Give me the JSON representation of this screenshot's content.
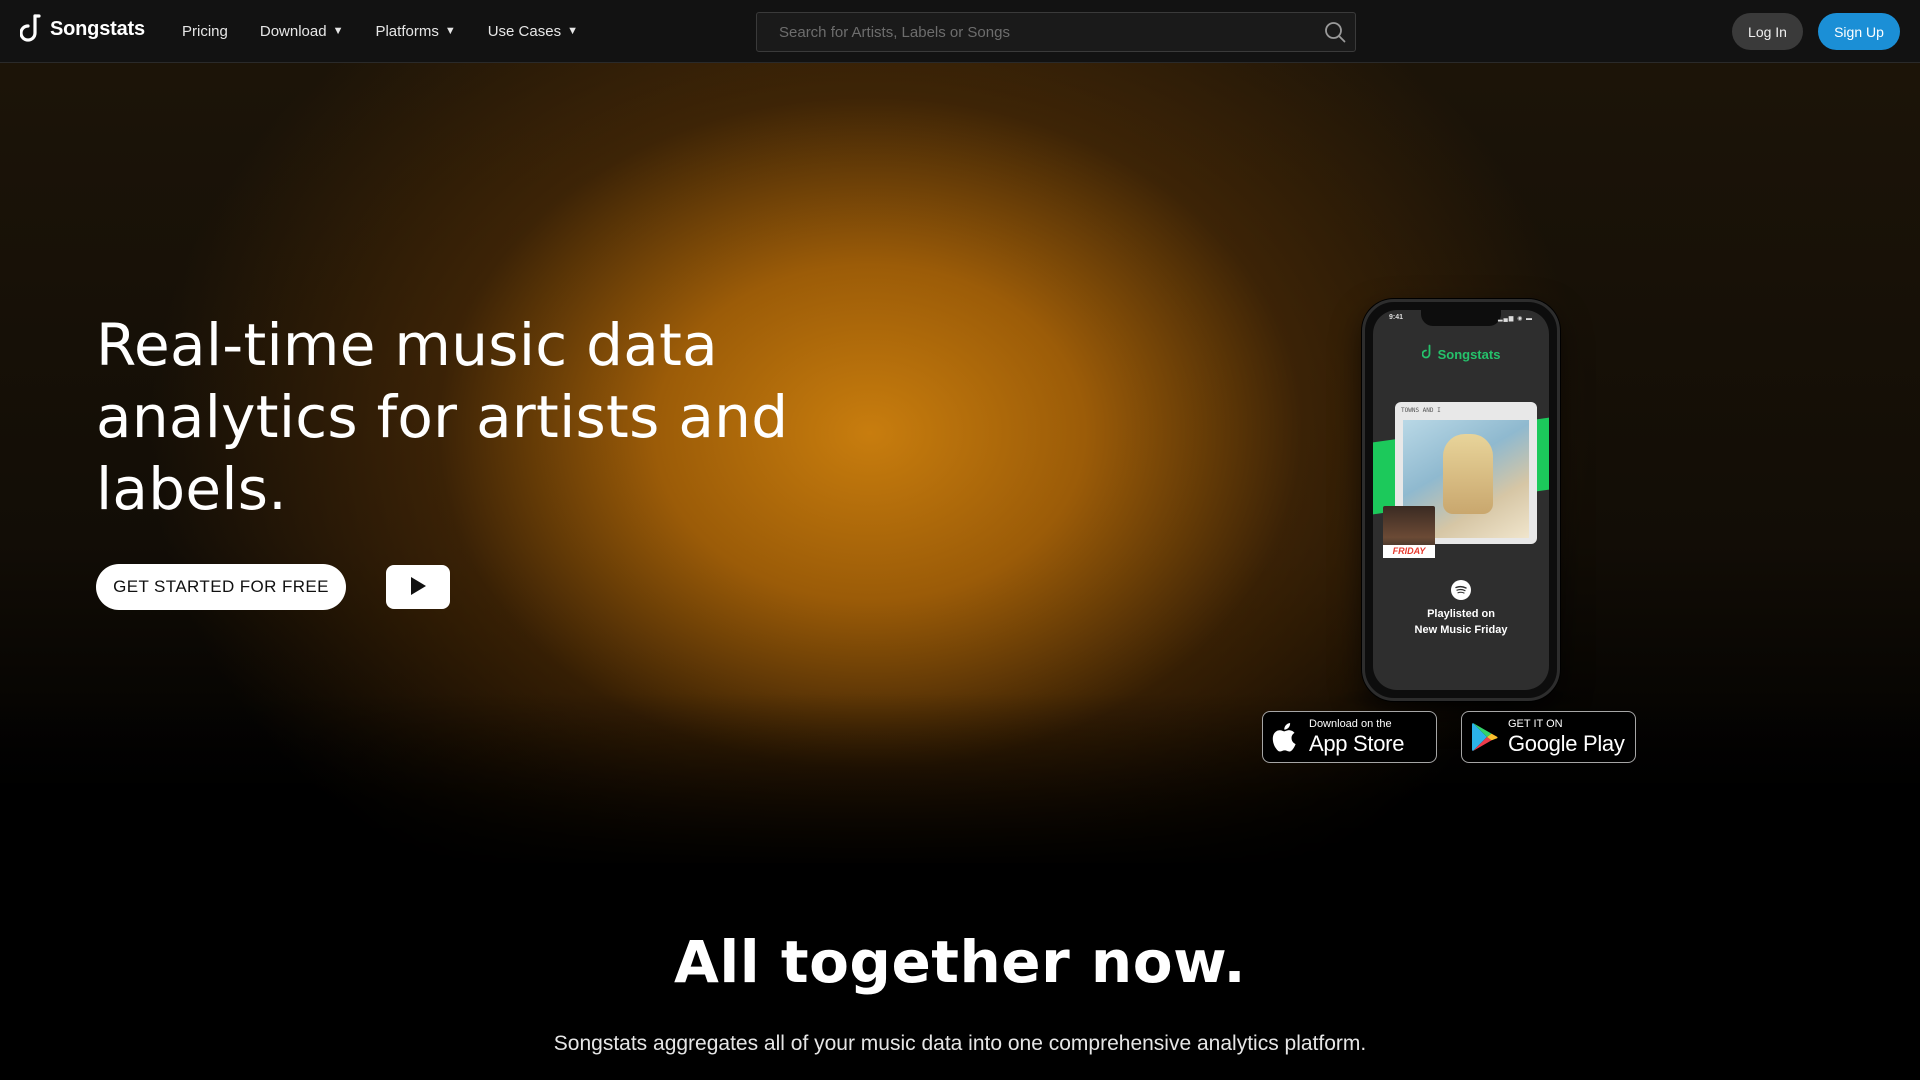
{
  "nav": {
    "brand": "Songstats",
    "links": [
      {
        "label": "Pricing",
        "dropdown": false
      },
      {
        "label": "Download",
        "dropdown": true
      },
      {
        "label": "Platforms",
        "dropdown": true
      },
      {
        "label": "Use Cases",
        "dropdown": true
      }
    ],
    "caret": "▼",
    "search_placeholder": "Search for Artists, Labels or Songs",
    "login_label": "Log In",
    "signup_label": "Sign Up"
  },
  "hero": {
    "title": "Real-time music data analytics for artists and labels.",
    "cta_label": "GET STARTED FOR FREE",
    "play_icon": "play-icon"
  },
  "phone": {
    "time": "9:41",
    "brand": "Songstats",
    "album_caption": "TOWNS AND I",
    "friday_label": "FRIDAY",
    "caption_line1": "Playlisted on",
    "caption_line2": "New Music Friday"
  },
  "badges": {
    "apple_small": "Download on the",
    "apple_big": "App Store",
    "google_small": "GET IT ON",
    "google_big": "Google Play"
  },
  "section": {
    "title": "All together now.",
    "subtitle": "Songstats aggregates all of your music data into one comprehensive analytics platform."
  },
  "colors": {
    "accent_blue": "#1b8fd6",
    "brand_green": "#25c26b",
    "hero_orange": "#c87d0e"
  }
}
